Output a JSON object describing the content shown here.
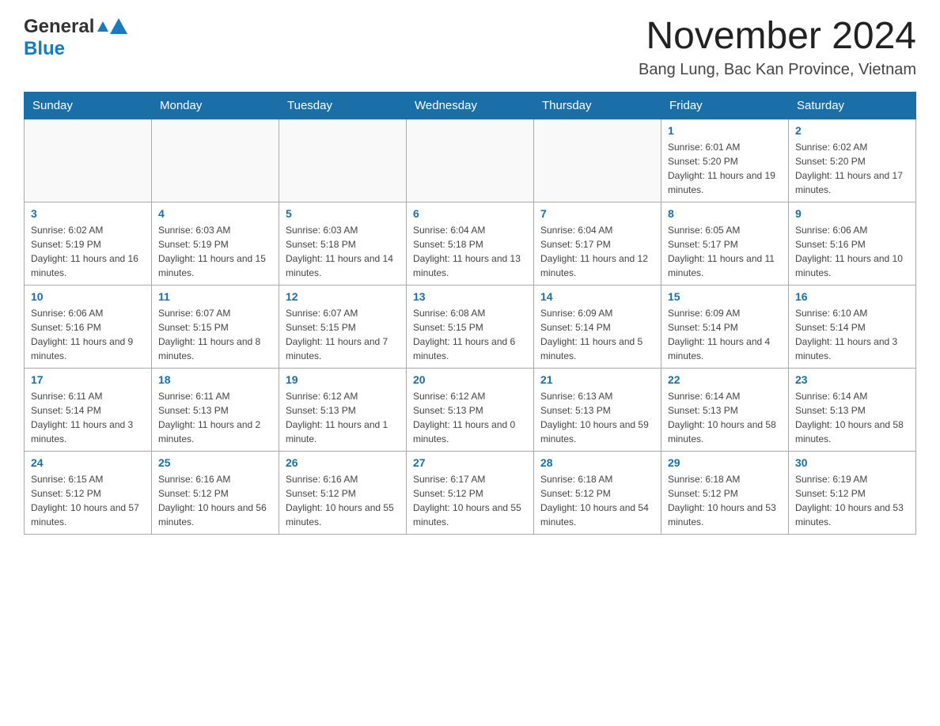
{
  "header": {
    "logo_general": "General",
    "logo_blue": "Blue",
    "title": "November 2024",
    "subtitle": "Bang Lung, Bac Kan Province, Vietnam"
  },
  "calendar": {
    "days_of_week": [
      "Sunday",
      "Monday",
      "Tuesday",
      "Wednesday",
      "Thursday",
      "Friday",
      "Saturday"
    ],
    "weeks": [
      [
        {
          "day": "",
          "info": ""
        },
        {
          "day": "",
          "info": ""
        },
        {
          "day": "",
          "info": ""
        },
        {
          "day": "",
          "info": ""
        },
        {
          "day": "",
          "info": ""
        },
        {
          "day": "1",
          "info": "Sunrise: 6:01 AM\nSunset: 5:20 PM\nDaylight: 11 hours and 19 minutes."
        },
        {
          "day": "2",
          "info": "Sunrise: 6:02 AM\nSunset: 5:20 PM\nDaylight: 11 hours and 17 minutes."
        }
      ],
      [
        {
          "day": "3",
          "info": "Sunrise: 6:02 AM\nSunset: 5:19 PM\nDaylight: 11 hours and 16 minutes."
        },
        {
          "day": "4",
          "info": "Sunrise: 6:03 AM\nSunset: 5:19 PM\nDaylight: 11 hours and 15 minutes."
        },
        {
          "day": "5",
          "info": "Sunrise: 6:03 AM\nSunset: 5:18 PM\nDaylight: 11 hours and 14 minutes."
        },
        {
          "day": "6",
          "info": "Sunrise: 6:04 AM\nSunset: 5:18 PM\nDaylight: 11 hours and 13 minutes."
        },
        {
          "day": "7",
          "info": "Sunrise: 6:04 AM\nSunset: 5:17 PM\nDaylight: 11 hours and 12 minutes."
        },
        {
          "day": "8",
          "info": "Sunrise: 6:05 AM\nSunset: 5:17 PM\nDaylight: 11 hours and 11 minutes."
        },
        {
          "day": "9",
          "info": "Sunrise: 6:06 AM\nSunset: 5:16 PM\nDaylight: 11 hours and 10 minutes."
        }
      ],
      [
        {
          "day": "10",
          "info": "Sunrise: 6:06 AM\nSunset: 5:16 PM\nDaylight: 11 hours and 9 minutes."
        },
        {
          "day": "11",
          "info": "Sunrise: 6:07 AM\nSunset: 5:15 PM\nDaylight: 11 hours and 8 minutes."
        },
        {
          "day": "12",
          "info": "Sunrise: 6:07 AM\nSunset: 5:15 PM\nDaylight: 11 hours and 7 minutes."
        },
        {
          "day": "13",
          "info": "Sunrise: 6:08 AM\nSunset: 5:15 PM\nDaylight: 11 hours and 6 minutes."
        },
        {
          "day": "14",
          "info": "Sunrise: 6:09 AM\nSunset: 5:14 PM\nDaylight: 11 hours and 5 minutes."
        },
        {
          "day": "15",
          "info": "Sunrise: 6:09 AM\nSunset: 5:14 PM\nDaylight: 11 hours and 4 minutes."
        },
        {
          "day": "16",
          "info": "Sunrise: 6:10 AM\nSunset: 5:14 PM\nDaylight: 11 hours and 3 minutes."
        }
      ],
      [
        {
          "day": "17",
          "info": "Sunrise: 6:11 AM\nSunset: 5:14 PM\nDaylight: 11 hours and 3 minutes."
        },
        {
          "day": "18",
          "info": "Sunrise: 6:11 AM\nSunset: 5:13 PM\nDaylight: 11 hours and 2 minutes."
        },
        {
          "day": "19",
          "info": "Sunrise: 6:12 AM\nSunset: 5:13 PM\nDaylight: 11 hours and 1 minute."
        },
        {
          "day": "20",
          "info": "Sunrise: 6:12 AM\nSunset: 5:13 PM\nDaylight: 11 hours and 0 minutes."
        },
        {
          "day": "21",
          "info": "Sunrise: 6:13 AM\nSunset: 5:13 PM\nDaylight: 10 hours and 59 minutes."
        },
        {
          "day": "22",
          "info": "Sunrise: 6:14 AM\nSunset: 5:13 PM\nDaylight: 10 hours and 58 minutes."
        },
        {
          "day": "23",
          "info": "Sunrise: 6:14 AM\nSunset: 5:13 PM\nDaylight: 10 hours and 58 minutes."
        }
      ],
      [
        {
          "day": "24",
          "info": "Sunrise: 6:15 AM\nSunset: 5:12 PM\nDaylight: 10 hours and 57 minutes."
        },
        {
          "day": "25",
          "info": "Sunrise: 6:16 AM\nSunset: 5:12 PM\nDaylight: 10 hours and 56 minutes."
        },
        {
          "day": "26",
          "info": "Sunrise: 6:16 AM\nSunset: 5:12 PM\nDaylight: 10 hours and 55 minutes."
        },
        {
          "day": "27",
          "info": "Sunrise: 6:17 AM\nSunset: 5:12 PM\nDaylight: 10 hours and 55 minutes."
        },
        {
          "day": "28",
          "info": "Sunrise: 6:18 AM\nSunset: 5:12 PM\nDaylight: 10 hours and 54 minutes."
        },
        {
          "day": "29",
          "info": "Sunrise: 6:18 AM\nSunset: 5:12 PM\nDaylight: 10 hours and 53 minutes."
        },
        {
          "day": "30",
          "info": "Sunrise: 6:19 AM\nSunset: 5:12 PM\nDaylight: 10 hours and 53 minutes."
        }
      ]
    ]
  }
}
